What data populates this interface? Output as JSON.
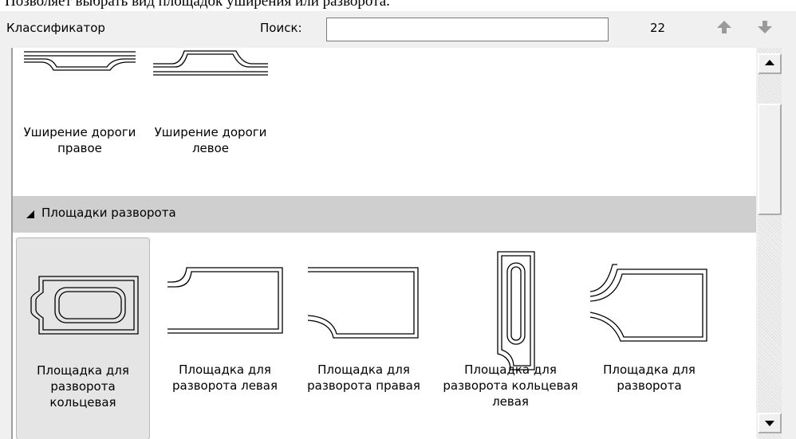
{
  "caption": "Позволяет выбрать вид площадок уширения или разворота.",
  "toolbar": {
    "classifier_label": "Классификатор",
    "search_label": "Поиск:",
    "search_value": "",
    "count": "22"
  },
  "icons": {
    "arrow_up": "arrow-up-icon",
    "arrow_down": "arrow-down-icon",
    "triangle": "expand-triangle-icon"
  },
  "widening_items": [
    {
      "label": "Уширение дороги правое"
    },
    {
      "label": "Уширение дороги левое"
    }
  ],
  "group": {
    "title": "Площадки разворота"
  },
  "turnaround_items": [
    {
      "label": "Площадка для разворота кольцевая",
      "selected": true
    },
    {
      "label": "Площадка для разворота левая"
    },
    {
      "label": "Площадка для разворота правая"
    },
    {
      "label": "Площадка для разворота кольцевая левая"
    },
    {
      "label": "Площадка для разворота"
    }
  ]
}
